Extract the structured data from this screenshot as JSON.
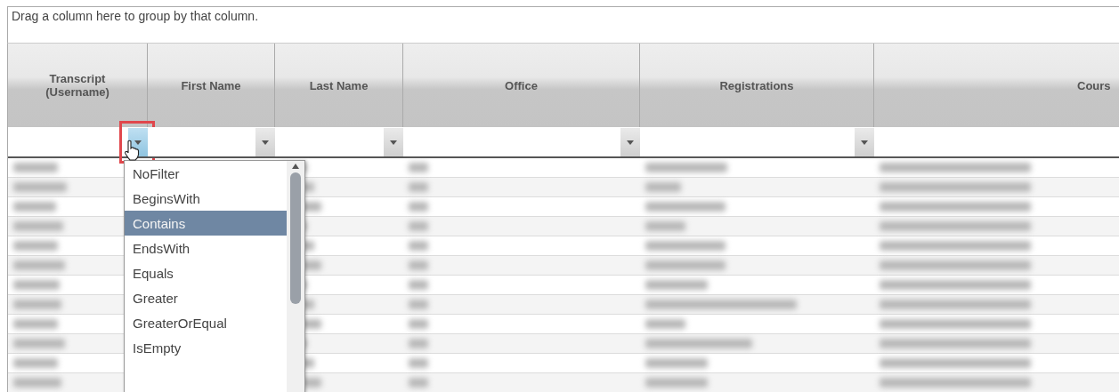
{
  "group_panel": {
    "hint": "Drag a column here to group by that column."
  },
  "columns": [
    {
      "title": "Transcript (Username)",
      "filter_hovered": true,
      "callout": true
    },
    {
      "title": "First Name",
      "filter_hovered": false,
      "callout": false
    },
    {
      "title": "Last Name",
      "filter_hovered": false,
      "callout": false
    },
    {
      "title": "Office",
      "filter_hovered": false,
      "callout": false
    },
    {
      "title": "Registrations",
      "filter_hovered": false,
      "callout": false
    },
    {
      "title": "Cours",
      "kind": "cut"
    }
  ],
  "rows": [
    {
      "kind": "redacted"
    },
    {
      "kind": "redacted"
    },
    {
      "kind": "redacted"
    },
    {
      "kind": "redacted"
    },
    {
      "kind": "redacted"
    },
    {
      "kind": "redacted"
    },
    {
      "kind": "redacted"
    },
    {
      "kind": "redacted"
    },
    {
      "kind": "redacted"
    },
    {
      "kind": "redacted"
    },
    {
      "kind": "redacted"
    },
    {
      "kind": "redacted"
    }
  ],
  "filter_menu": {
    "options": [
      {
        "label": "NoFilter",
        "selected": false
      },
      {
        "label": "BeginsWith",
        "selected": false
      },
      {
        "label": "Contains",
        "selected": true
      },
      {
        "label": "EndsWith",
        "selected": false
      },
      {
        "label": "Equals",
        "selected": false
      },
      {
        "label": "Greater",
        "selected": false
      },
      {
        "label": "GreaterOrEqual",
        "selected": false
      },
      {
        "label": "IsEmpty",
        "selected": false
      }
    ]
  }
}
